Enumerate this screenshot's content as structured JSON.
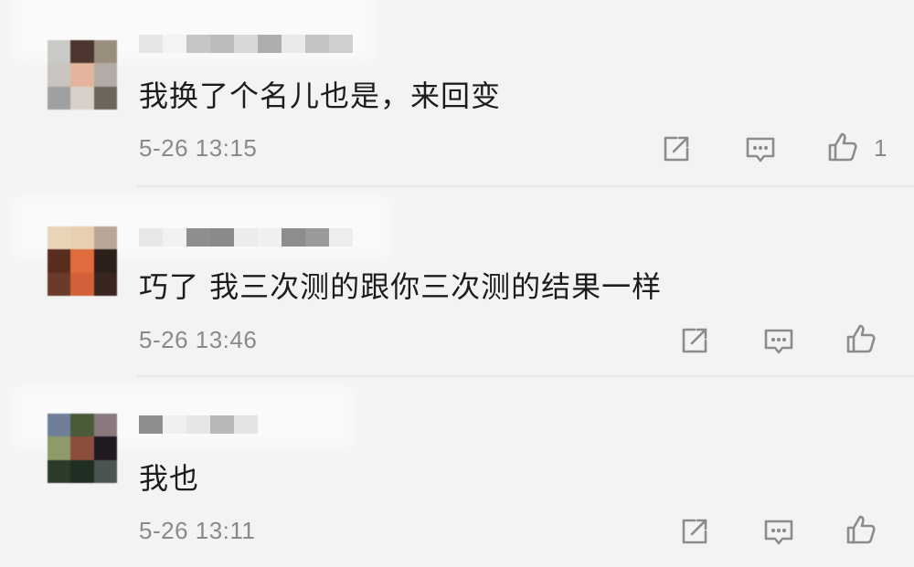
{
  "comments": [
    {
      "text": "我换了个名儿也是，来回变",
      "time": "5-26 13:15",
      "like_count": "1",
      "avatar_colors": [
        "#c9c9c6",
        "#4d3530",
        "#9a8e7f",
        "#c8c4c0",
        "#e2b59c",
        "#b3aca4",
        "#9fa0a0",
        "#d7d1c9",
        "#6e655c"
      ],
      "name_colors": [
        "#e6e6e6",
        "#f3f3f3",
        "#c6c6c6",
        "#bcbcbc",
        "#d8d8d8",
        "#aeaeae",
        "#e9e9e9",
        "#c4c4c4",
        "#cfcfcf"
      ]
    },
    {
      "text": "巧了 我三次测的跟你三次测的结果一样",
      "time": "5-26 13:46",
      "like_count": "",
      "avatar_colors": [
        "#e8d5b7",
        "#e8cfb0",
        "#b9a699",
        "#5a2e1f",
        "#e06b3d",
        "#2c1f1a",
        "#6a3a2a",
        "#d26038",
        "#3a2520"
      ],
      "name_colors": [
        "#e8e8e8",
        "#f1f1f1",
        "#8e8e8e",
        "#8a8a8a",
        "#ececec",
        "#f0f0f0",
        "#8d8d8d",
        "#9a9a9a",
        "#ededed"
      ]
    },
    {
      "text": "我也",
      "time": "5-26 13:11",
      "like_count": "",
      "avatar_colors": [
        "#6f7f9a",
        "#4a5b3a",
        "#8a7a7e",
        "#8e9a6a",
        "#8a4e3a",
        "#221a22",
        "#2b3b2a",
        "#1f2e22",
        "#4a5450"
      ],
      "name_colors": [
        "#8e8e8e",
        "#f0f0f0",
        "#e6e6e6",
        "#b8b8b8",
        "#e4e4e4"
      ]
    }
  ],
  "icons": {
    "share": "share-icon",
    "reply": "comment-icon",
    "like": "thumbs-up-icon"
  },
  "colors": {
    "background": "#f3f3f3",
    "text": "#1c1c1c",
    "meta": "#8a8a8a",
    "icon": "#8c8c8c"
  }
}
